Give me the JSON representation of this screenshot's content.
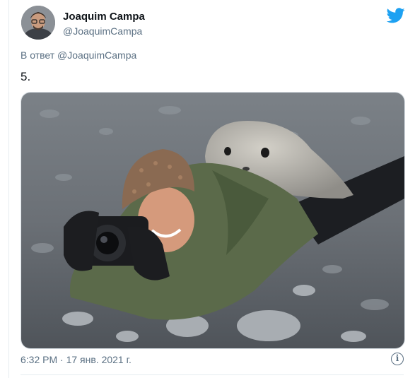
{
  "tweet": {
    "author_name": "Joaquim Campa",
    "author_handle": "@JoaquimCampa",
    "reply_prefix": "В ответ",
    "reply_to": "@JoaquimCampa",
    "text": "5.",
    "timestamp": "6:32 PM · 17 янв. 2021 г.",
    "info_glyph": "i"
  },
  "icons": {
    "brand": "twitter-bird-icon",
    "info": "info-icon"
  },
  "colors": {
    "brand_blue": "#1da1f2",
    "secondary_text": "#5b7083",
    "primary_text": "#0f1419"
  }
}
